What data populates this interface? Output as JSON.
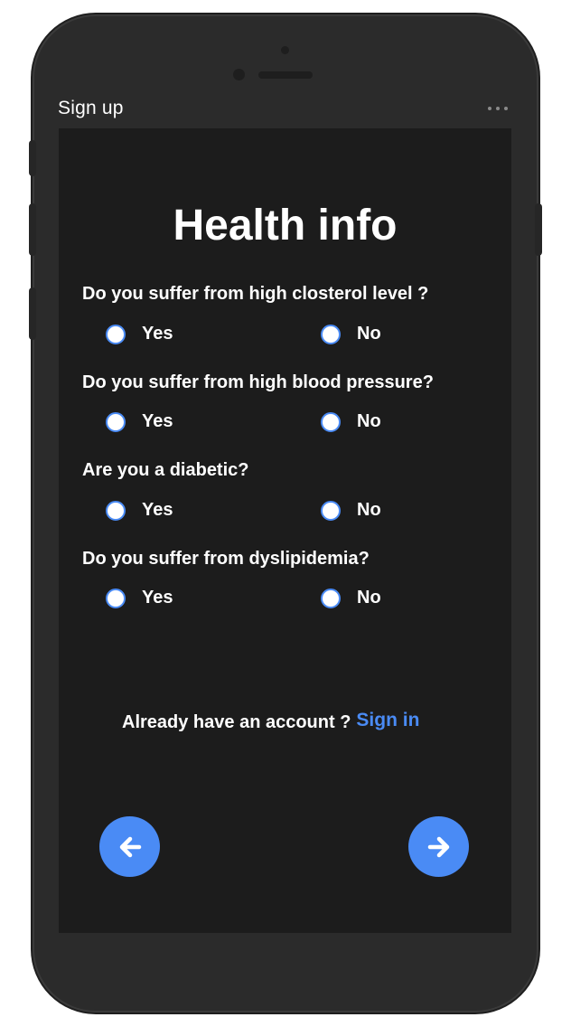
{
  "frame": {
    "title": "Sign up",
    "menu_icon": "more-horizontal-icon"
  },
  "page": {
    "heading": "Health info"
  },
  "questions": [
    {
      "text": "Do you suffer from high closterol level ?",
      "yes": "Yes",
      "no": "No"
    },
    {
      "text": "Do you suffer from high blood pressure?",
      "yes": "Yes",
      "no": "No"
    },
    {
      "text": "Are you a diabetic?",
      "yes": "Yes",
      "no": "No"
    },
    {
      "text": "Do you suffer from dyslipidemia?",
      "yes": "Yes",
      "no": "No"
    }
  ],
  "account": {
    "prompt": "Already have an account ?",
    "link": "Sign in"
  },
  "nav": {
    "back_icon": "arrow-left-icon",
    "next_icon": "arrow-right-icon"
  },
  "colors": {
    "accent": "#4a8bf5",
    "screen_bg": "#1c1c1c",
    "device_body": "#2b2b2b",
    "text": "#ffffff"
  }
}
